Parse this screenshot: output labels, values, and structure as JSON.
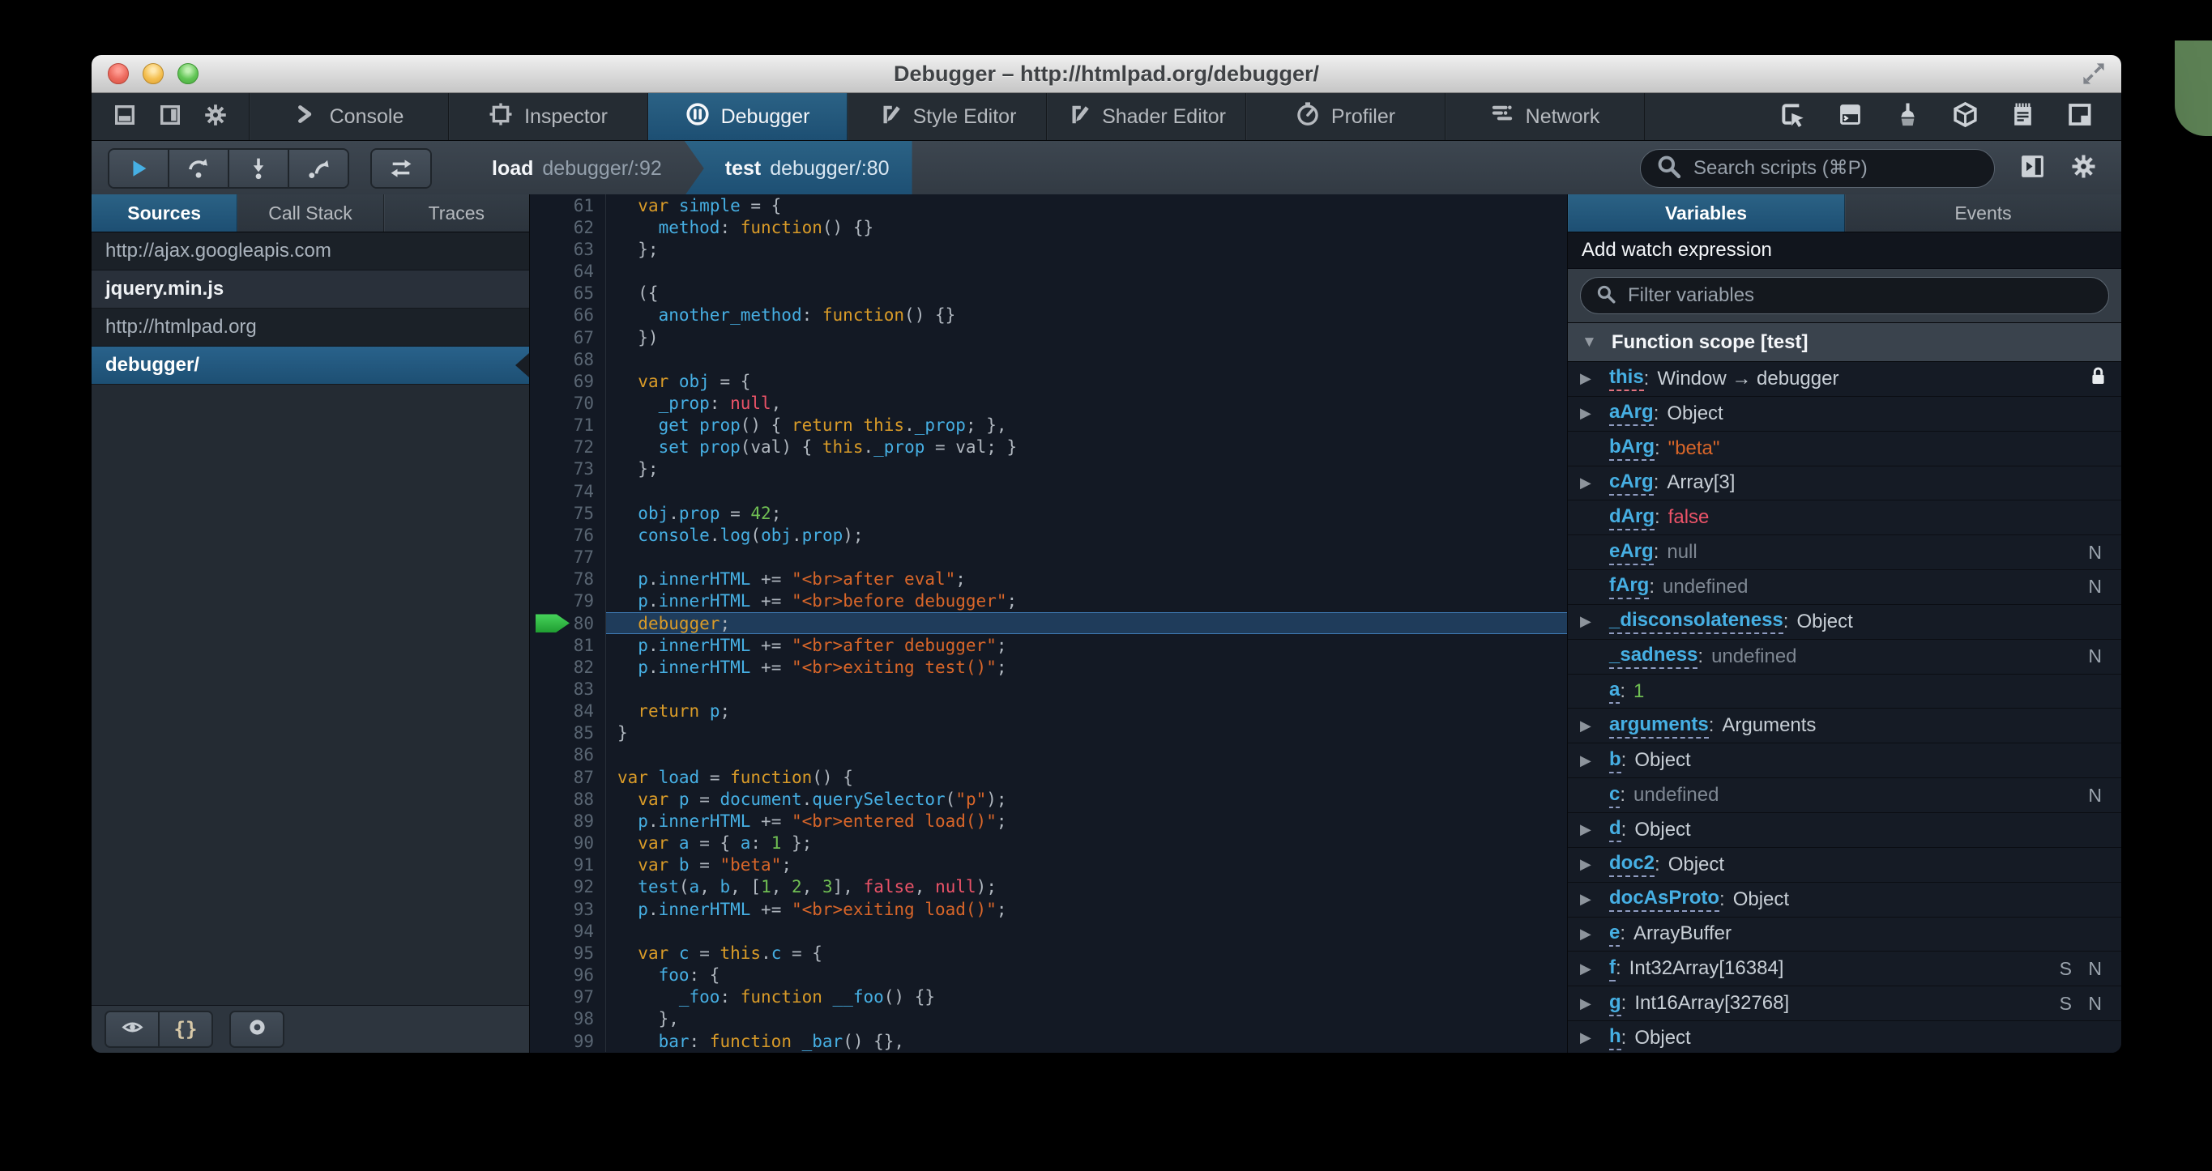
{
  "window": {
    "title": "Debugger – http://htmlpad.org/debugger/"
  },
  "toolbox": {
    "tabs": [
      {
        "label": "Console",
        "icon": "console",
        "active": false
      },
      {
        "label": "Inspector",
        "icon": "inspector",
        "active": false
      },
      {
        "label": "Debugger",
        "icon": "debugger",
        "active": true
      },
      {
        "label": "Style Editor",
        "icon": "style-editor",
        "active": false
      },
      {
        "label": "Shader Editor",
        "icon": "shader-editor",
        "active": false
      },
      {
        "label": "Profiler",
        "icon": "profiler",
        "active": false
      },
      {
        "label": "Network",
        "icon": "network",
        "active": false
      }
    ],
    "right_buttons": [
      "pick",
      "split-console",
      "paintbrush",
      "cube",
      "scratchpad",
      "responsive"
    ]
  },
  "debug_toolbar": {
    "breadcrumbs": [
      {
        "fn": "load",
        "loc": "debugger/:92",
        "active": false
      },
      {
        "fn": "test",
        "loc": "debugger/:80",
        "active": true
      }
    ],
    "search_placeholder": "Search scripts (⌘P)"
  },
  "sidebar": {
    "tabs": [
      {
        "label": "Sources",
        "active": true
      },
      {
        "label": "Call Stack",
        "active": false
      },
      {
        "label": "Traces",
        "active": false
      }
    ],
    "items": [
      {
        "label": "http://ajax.googleapis.com",
        "type": "group"
      },
      {
        "label": "jquery.min.js",
        "type": "item"
      },
      {
        "label": "http://htmlpad.org",
        "type": "group"
      },
      {
        "label": "debugger/",
        "type": "item",
        "selected": true
      }
    ]
  },
  "editor": {
    "highlight_line": 80,
    "lines": [
      {
        "n": 61,
        "t": [
          [
            "d",
            "  "
          ],
          [
            "k",
            "var"
          ],
          [
            "d",
            " "
          ],
          [
            "i",
            "simple"
          ],
          [
            "d",
            " = {"
          ]
        ]
      },
      {
        "n": 62,
        "t": [
          [
            "d",
            "    "
          ],
          [
            "i",
            "method"
          ],
          [
            "d",
            ": "
          ],
          [
            "k",
            "function"
          ],
          [
            "d",
            "() {}"
          ]
        ]
      },
      {
        "n": 63,
        "t": [
          [
            "d",
            "  };"
          ]
        ]
      },
      {
        "n": 64,
        "t": []
      },
      {
        "n": 65,
        "t": [
          [
            "d",
            "  ({"
          ]
        ]
      },
      {
        "n": 66,
        "t": [
          [
            "d",
            "    "
          ],
          [
            "i",
            "another_method"
          ],
          [
            "d",
            ": "
          ],
          [
            "k",
            "function"
          ],
          [
            "d",
            "() {}"
          ]
        ]
      },
      {
        "n": 67,
        "t": [
          [
            "d",
            "  })"
          ]
        ]
      },
      {
        "n": 68,
        "t": []
      },
      {
        "n": 69,
        "t": [
          [
            "d",
            "  "
          ],
          [
            "k",
            "var"
          ],
          [
            "d",
            " "
          ],
          [
            "i",
            "obj"
          ],
          [
            "d",
            " = {"
          ]
        ]
      },
      {
        "n": 70,
        "t": [
          [
            "d",
            "    "
          ],
          [
            "i",
            "_prop"
          ],
          [
            "d",
            ": "
          ],
          [
            "a",
            "null"
          ],
          [
            "d",
            ","
          ]
        ]
      },
      {
        "n": 71,
        "t": [
          [
            "d",
            "    "
          ],
          [
            "i",
            "get"
          ],
          [
            "d",
            " "
          ],
          [
            "i",
            "prop"
          ],
          [
            "d",
            "() { "
          ],
          [
            "k",
            "return"
          ],
          [
            "d",
            " "
          ],
          [
            "k",
            "this"
          ],
          [
            "d",
            "."
          ],
          [
            "i",
            "_prop"
          ],
          [
            "d",
            "; },"
          ]
        ]
      },
      {
        "n": 72,
        "t": [
          [
            "d",
            "    "
          ],
          [
            "i",
            "set"
          ],
          [
            "d",
            " "
          ],
          [
            "i",
            "prop"
          ],
          [
            "d",
            "(val) { "
          ],
          [
            "k",
            "this"
          ],
          [
            "d",
            "."
          ],
          [
            "i",
            "_prop"
          ],
          [
            "d",
            " = val; }"
          ]
        ]
      },
      {
        "n": 73,
        "t": [
          [
            "d",
            "  };"
          ]
        ]
      },
      {
        "n": 74,
        "t": []
      },
      {
        "n": 75,
        "t": [
          [
            "d",
            "  "
          ],
          [
            "i",
            "obj"
          ],
          [
            "d",
            "."
          ],
          [
            "i",
            "prop"
          ],
          [
            "d",
            " = "
          ],
          [
            "n",
            "42"
          ],
          [
            "d",
            ";"
          ]
        ]
      },
      {
        "n": 76,
        "t": [
          [
            "d",
            "  "
          ],
          [
            "i",
            "console"
          ],
          [
            "d",
            "."
          ],
          [
            "i",
            "log"
          ],
          [
            "d",
            "("
          ],
          [
            "i",
            "obj"
          ],
          [
            "d",
            "."
          ],
          [
            "i",
            "prop"
          ],
          [
            "d",
            ");"
          ]
        ]
      },
      {
        "n": 77,
        "t": []
      },
      {
        "n": 78,
        "t": [
          [
            "d",
            "  "
          ],
          [
            "i",
            "p"
          ],
          [
            "d",
            "."
          ],
          [
            "i",
            "innerHTML"
          ],
          [
            "d",
            " += "
          ],
          [
            "s",
            "\"<br>after eval\""
          ],
          [
            "d",
            ";"
          ]
        ]
      },
      {
        "n": 79,
        "t": [
          [
            "d",
            "  "
          ],
          [
            "i",
            "p"
          ],
          [
            "d",
            "."
          ],
          [
            "i",
            "innerHTML"
          ],
          [
            "d",
            " += "
          ],
          [
            "s",
            "\"<br>before debugger\""
          ],
          [
            "d",
            ";"
          ]
        ]
      },
      {
        "n": 80,
        "t": [
          [
            "d",
            "  "
          ],
          [
            "k",
            "debugger"
          ],
          [
            "d",
            ";"
          ]
        ]
      },
      {
        "n": 81,
        "t": [
          [
            "d",
            "  "
          ],
          [
            "i",
            "p"
          ],
          [
            "d",
            "."
          ],
          [
            "i",
            "innerHTML"
          ],
          [
            "d",
            " += "
          ],
          [
            "s",
            "\"<br>after debugger\""
          ],
          [
            "d",
            ";"
          ]
        ]
      },
      {
        "n": 82,
        "t": [
          [
            "d",
            "  "
          ],
          [
            "i",
            "p"
          ],
          [
            "d",
            "."
          ],
          [
            "i",
            "innerHTML"
          ],
          [
            "d",
            " += "
          ],
          [
            "s",
            "\"<br>exiting test()\""
          ],
          [
            "d",
            ";"
          ]
        ]
      },
      {
        "n": 83,
        "t": []
      },
      {
        "n": 84,
        "t": [
          [
            "d",
            "  "
          ],
          [
            "k",
            "return"
          ],
          [
            "d",
            " "
          ],
          [
            "i",
            "p"
          ],
          [
            "d",
            ";"
          ]
        ]
      },
      {
        "n": 85,
        "t": [
          [
            "d",
            "}"
          ]
        ]
      },
      {
        "n": 86,
        "t": []
      },
      {
        "n": 87,
        "t": [
          [
            "k",
            "var"
          ],
          [
            "d",
            " "
          ],
          [
            "i",
            "load"
          ],
          [
            "d",
            " = "
          ],
          [
            "k",
            "function"
          ],
          [
            "d",
            "() {"
          ]
        ]
      },
      {
        "n": 88,
        "t": [
          [
            "d",
            "  "
          ],
          [
            "k",
            "var"
          ],
          [
            "d",
            " "
          ],
          [
            "i",
            "p"
          ],
          [
            "d",
            " = "
          ],
          [
            "i",
            "document"
          ],
          [
            "d",
            "."
          ],
          [
            "i",
            "querySelector"
          ],
          [
            "d",
            "("
          ],
          [
            "s",
            "\"p\""
          ],
          [
            "d",
            ");"
          ]
        ]
      },
      {
        "n": 89,
        "t": [
          [
            "d",
            "  "
          ],
          [
            "i",
            "p"
          ],
          [
            "d",
            "."
          ],
          [
            "i",
            "innerHTML"
          ],
          [
            "d",
            " += "
          ],
          [
            "s",
            "\"<br>entered load()\""
          ],
          [
            "d",
            ";"
          ]
        ]
      },
      {
        "n": 90,
        "t": [
          [
            "d",
            "  "
          ],
          [
            "k",
            "var"
          ],
          [
            "d",
            " "
          ],
          [
            "i",
            "a"
          ],
          [
            "d",
            " = { "
          ],
          [
            "i",
            "a"
          ],
          [
            "d",
            ": "
          ],
          [
            "n",
            "1"
          ],
          [
            "d",
            " };"
          ]
        ]
      },
      {
        "n": 91,
        "t": [
          [
            "d",
            "  "
          ],
          [
            "k",
            "var"
          ],
          [
            "d",
            " "
          ],
          [
            "i",
            "b"
          ],
          [
            "d",
            " = "
          ],
          [
            "s",
            "\"beta\""
          ],
          [
            "d",
            ";"
          ]
        ]
      },
      {
        "n": 92,
        "t": [
          [
            "d",
            "  "
          ],
          [
            "i",
            "test"
          ],
          [
            "d",
            "("
          ],
          [
            "i",
            "a"
          ],
          [
            "d",
            ", "
          ],
          [
            "i",
            "b"
          ],
          [
            "d",
            ", ["
          ],
          [
            "n",
            "1"
          ],
          [
            "d",
            ", "
          ],
          [
            "n",
            "2"
          ],
          [
            "d",
            ", "
          ],
          [
            "n",
            "3"
          ],
          [
            "d",
            "], "
          ],
          [
            "a",
            "false"
          ],
          [
            "d",
            ", "
          ],
          [
            "a",
            "null"
          ],
          [
            "d",
            ");"
          ]
        ]
      },
      {
        "n": 93,
        "t": [
          [
            "d",
            "  "
          ],
          [
            "i",
            "p"
          ],
          [
            "d",
            "."
          ],
          [
            "i",
            "innerHTML"
          ],
          [
            "d",
            " += "
          ],
          [
            "s",
            "\"<br>exiting load()\""
          ],
          [
            "d",
            ";"
          ]
        ]
      },
      {
        "n": 94,
        "t": []
      },
      {
        "n": 95,
        "t": [
          [
            "d",
            "  "
          ],
          [
            "k",
            "var"
          ],
          [
            "d",
            " "
          ],
          [
            "i",
            "c"
          ],
          [
            "d",
            " = "
          ],
          [
            "k",
            "this"
          ],
          [
            "d",
            "."
          ],
          [
            "i",
            "c"
          ],
          [
            "d",
            " = {"
          ]
        ]
      },
      {
        "n": 96,
        "t": [
          [
            "d",
            "    "
          ],
          [
            "i",
            "foo"
          ],
          [
            "d",
            ": {"
          ]
        ]
      },
      {
        "n": 97,
        "t": [
          [
            "d",
            "      "
          ],
          [
            "i",
            "_foo"
          ],
          [
            "d",
            ": "
          ],
          [
            "k",
            "function"
          ],
          [
            "d",
            " "
          ],
          [
            "i",
            "__foo"
          ],
          [
            "d",
            "() {}"
          ]
        ]
      },
      {
        "n": 98,
        "t": [
          [
            "d",
            "    },"
          ]
        ]
      },
      {
        "n": 99,
        "t": [
          [
            "d",
            "    "
          ],
          [
            "i",
            "bar"
          ],
          [
            "d",
            ": "
          ],
          [
            "k",
            "function"
          ],
          [
            "d",
            " "
          ],
          [
            "i",
            "_bar"
          ],
          [
            "d",
            "() {},"
          ]
        ]
      }
    ]
  },
  "variables_panel": {
    "tabs": [
      {
        "label": "Variables",
        "active": true
      },
      {
        "label": "Events",
        "active": false
      }
    ],
    "add_watch_label": "Add watch expression",
    "filter_placeholder": "Filter variables",
    "scope_label": "Function scope [test]",
    "rows": [
      {
        "name": "this",
        "value": "Window → debugger",
        "vclass": "obj",
        "expander": true,
        "underline": "red",
        "lock": true
      },
      {
        "name": "aArg",
        "value": "Object",
        "vclass": "obj",
        "expander": true
      },
      {
        "name": "bArg",
        "value": "\"beta\"",
        "vclass": "str"
      },
      {
        "name": "cArg",
        "value": "Array[3]",
        "vclass": "obj",
        "expander": true
      },
      {
        "name": "dArg",
        "value": "false",
        "vclass": "red"
      },
      {
        "name": "eArg",
        "value": "null",
        "vclass": "dim",
        "badge": "N"
      },
      {
        "name": "fArg",
        "value": "undefined",
        "vclass": "dim",
        "badge": "N"
      },
      {
        "name": "_disconsolateness",
        "value": "Object",
        "vclass": "obj",
        "expander": true
      },
      {
        "name": "_sadness",
        "value": "undefined",
        "vclass": "dim",
        "badge": "N"
      },
      {
        "name": "a",
        "value": "1",
        "vclass": "num"
      },
      {
        "name": "arguments",
        "value": "Arguments",
        "vclass": "obj",
        "expander": true
      },
      {
        "name": "b",
        "value": "Object",
        "vclass": "obj",
        "expander": true
      },
      {
        "name": "c",
        "value": "undefined",
        "vclass": "dim",
        "badge": "N"
      },
      {
        "name": "d",
        "value": "Object",
        "vclass": "obj",
        "expander": true
      },
      {
        "name": "doc2",
        "value": "Object",
        "vclass": "obj",
        "expander": true
      },
      {
        "name": "docAsProto",
        "value": "Object",
        "vclass": "obj",
        "expander": true
      },
      {
        "name": "e",
        "value": "ArrayBuffer",
        "vclass": "obj",
        "expander": true
      },
      {
        "name": "f",
        "value": "Int32Array[16384]",
        "vclass": "obj",
        "expander": true,
        "badge": "S N"
      },
      {
        "name": "g",
        "value": "Int16Array[32768]",
        "vclass": "obj",
        "expander": true,
        "badge": "S N"
      },
      {
        "name": "h",
        "value": "Object",
        "vclass": "obj",
        "expander": true
      }
    ]
  },
  "colors": {
    "accent_blue": "#1d4f73",
    "syntax_keyword": "#d99b28",
    "syntax_identifier": "#46afe3",
    "syntax_string": "#d96629",
    "syntax_number": "#70bf53",
    "syntax_atom": "#eb5368",
    "highlight_line_border": "#3f7cb6",
    "breakpoint_arrow": "#2cbb3f"
  }
}
